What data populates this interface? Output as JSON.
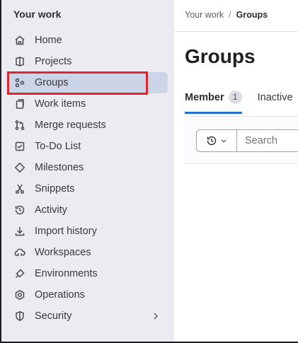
{
  "sidebar": {
    "heading": "Your work",
    "items": [
      {
        "label": "Home",
        "icon": "home-icon"
      },
      {
        "label": "Projects",
        "icon": "project-icon"
      },
      {
        "label": "Groups",
        "icon": "group-icon",
        "active": true
      },
      {
        "label": "Work items",
        "icon": "work-items-icon"
      },
      {
        "label": "Merge requests",
        "icon": "merge-request-icon"
      },
      {
        "label": "To-Do List",
        "icon": "todo-icon"
      },
      {
        "label": "Milestones",
        "icon": "milestone-icon"
      },
      {
        "label": "Snippets",
        "icon": "snippet-icon"
      },
      {
        "label": "Activity",
        "icon": "history-icon"
      },
      {
        "label": "Import history",
        "icon": "import-icon"
      },
      {
        "label": "Workspaces",
        "icon": "workspace-icon"
      },
      {
        "label": "Environments",
        "icon": "environment-icon"
      },
      {
        "label": "Operations",
        "icon": "operations-icon"
      },
      {
        "label": "Security",
        "icon": "shield-icon",
        "has_submenu": true
      }
    ]
  },
  "breadcrumb": {
    "parent": "Your work",
    "separator": "/",
    "current": "Groups"
  },
  "main": {
    "title": "Groups",
    "tabs": [
      {
        "label": "Member",
        "count": "1",
        "active": true
      },
      {
        "label": "Inactive",
        "active": false
      }
    ],
    "search": {
      "placeholder": "Search"
    }
  },
  "colors": {
    "sidebar_bg": "#ecebf1",
    "active_item_bg": "#cbd5e7",
    "highlight": "#e0262f",
    "tab_underline": "#1f75cb"
  }
}
